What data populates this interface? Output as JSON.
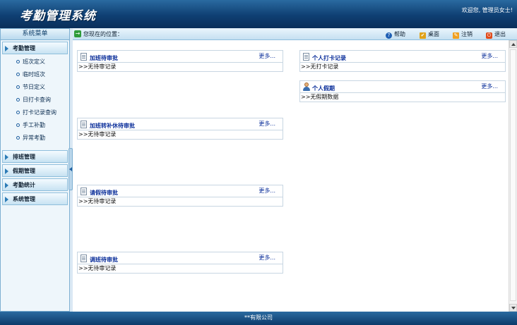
{
  "app": {
    "title": "考勤管理系统",
    "welcome": "欢迎您, 管理员女士!"
  },
  "sidebar": {
    "title": "系统菜单",
    "groups": [
      {
        "label": "考勤管理",
        "items": [
          "班次定义",
          "临时班次",
          "节日定义",
          "日打卡查询",
          "打卡记录查询",
          "手工补勤",
          "异常考勤"
        ]
      },
      {
        "label": "排班管理"
      },
      {
        "label": "假期管理"
      },
      {
        "label": "考勤统计"
      },
      {
        "label": "系统管理"
      }
    ]
  },
  "toolbar": {
    "location": "您现在的位置：",
    "help": "帮助",
    "desktop": "桌面",
    "logout": "注销",
    "exit": "退出"
  },
  "panels": [
    {
      "title": "加班待审批",
      "more": "更多...",
      "body": ">>无待审记录"
    },
    {
      "title": "加班转补休待审批",
      "more": "更多...",
      "body": ">>无待审记录"
    },
    {
      "title": "请假待审批",
      "more": "更多...",
      "body": ">>无待审记录"
    },
    {
      "title": "调班待审批",
      "more": "更多...",
      "body": ">>无待审记录"
    },
    {
      "title": "个人打卡记录",
      "more": "更多...",
      "body": ">>无打卡记录"
    },
    {
      "title": "个人假期",
      "more": "更多...",
      "body": ">>无假期数据"
    }
  ],
  "footer": {
    "text": "**有限公司"
  },
  "colors": {
    "header": "#0f3f73",
    "panel_title": "#0a2e9a",
    "sidebar_bg": "#eef6fb"
  }
}
